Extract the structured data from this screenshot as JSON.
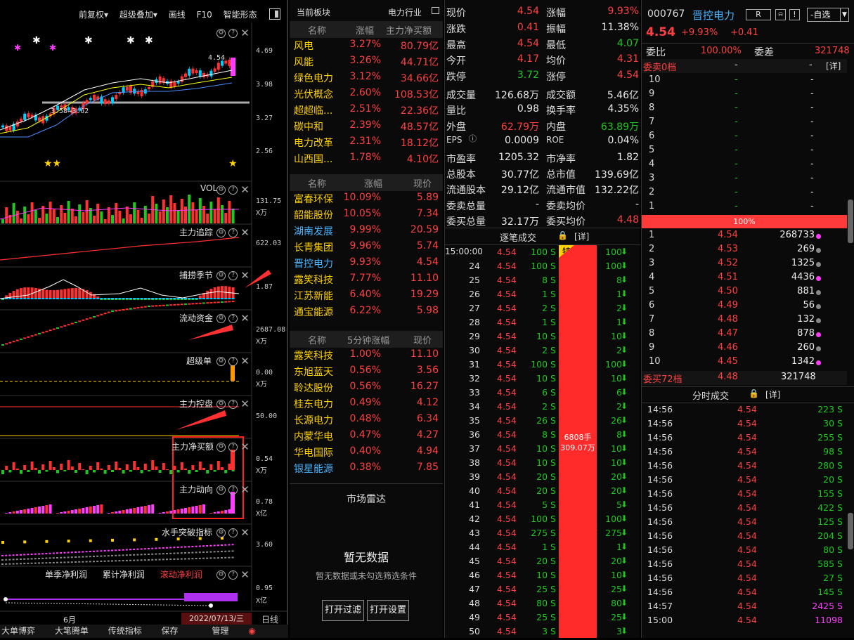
{
  "toolbar": {
    "fq": "前复权▾",
    "overlay": "超级叠加▾",
    "draw": "画线",
    "f10": "F10",
    "pattern": "智能形态"
  },
  "kline_axis": [
    "4.69",
    "3.98",
    "3.27",
    "2.56"
  ],
  "kline_annot": {
    "high": "4.54",
    "low": "3.58→3.62"
  },
  "panels": [
    {
      "title": "VOL",
      "axis": [
        "131.75",
        "X万"
      ]
    },
    {
      "title": "主力追踪",
      "axis": [
        "622.03"
      ]
    },
    {
      "title": "捕捞季节",
      "axis": [
        "1.87"
      ]
    },
    {
      "title": "流动资金",
      "axis": [
        "2687.08",
        "X万"
      ]
    },
    {
      "title": "超级单",
      "axis": [
        "0.00",
        "X万"
      ]
    },
    {
      "title": "主力控盘",
      "axis": [
        "50.00"
      ]
    },
    {
      "title": "主力净买额",
      "axis": [
        "0.54",
        "X万"
      ]
    },
    {
      "title": "主力动向",
      "axis": [
        "0.78",
        "X亿"
      ]
    },
    {
      "title": "水手突破指标",
      "axis": [
        "3.60"
      ]
    },
    {
      "title": "",
      "axis": [
        "0.95",
        "X亿"
      ]
    }
  ],
  "profit_legend": [
    "单季净利润",
    "累计净利润",
    "滚动净利润"
  ],
  "date_axis": {
    "month": "6月",
    "date": "2022/07/13/三",
    "period": "日线"
  },
  "bottom_tabs": [
    "大单博弈",
    "大笔腾单",
    "传统指标",
    "保存",
    "管理"
  ],
  "sector": {
    "header": {
      "label": "当前板块",
      "name": "电力行业"
    },
    "table1": {
      "cols": [
        "名称",
        "涨幅",
        "主力净买额"
      ],
      "rows": [
        [
          "风电",
          "3.27%",
          "80.79亿"
        ],
        [
          "风能",
          "3.26%",
          "44.71亿"
        ],
        [
          "绿色电力",
          "3.12%",
          "34.66亿"
        ],
        [
          "光伏概念",
          "2.60%",
          "108.53亿"
        ],
        [
          "超超临...",
          "2.51%",
          "22.36亿"
        ],
        [
          "碳中和",
          "2.39%",
          "48.57亿"
        ],
        [
          "电力改革",
          "2.31%",
          "18.12亿"
        ],
        [
          "山西国...",
          "1.78%",
          "4.10亿"
        ]
      ]
    },
    "table2": {
      "cols": [
        "名称",
        "涨幅",
        "现价"
      ],
      "rows": [
        [
          "富春环保",
          "10.09%",
          "5.89"
        ],
        [
          "韶能股份",
          "10.05%",
          "7.34"
        ],
        [
          "湖南发展",
          "9.99%",
          "20.59"
        ],
        [
          "长青集团",
          "9.96%",
          "5.74"
        ],
        [
          "晋控电力",
          "9.93%",
          "4.54"
        ],
        [
          "露笑科技",
          "7.77%",
          "11.10"
        ],
        [
          "江苏新能",
          "6.40%",
          "19.29"
        ],
        [
          "通宝能源",
          "6.22%",
          "5.98"
        ]
      ]
    },
    "table3": {
      "cols": [
        "名称",
        "5分钟涨幅",
        "现价"
      ],
      "rows": [
        [
          "露笑科技",
          "1.00%",
          "11.10"
        ],
        [
          "东旭蓝天",
          "0.56%",
          "3.56"
        ],
        [
          "聆达股份",
          "0.56%",
          "16.27"
        ],
        [
          "桂东电力",
          "0.49%",
          "4.12"
        ],
        [
          "长源电力",
          "0.48%",
          "6.34"
        ],
        [
          "内蒙华电",
          "0.47%",
          "4.27"
        ],
        [
          "华电国际",
          "0.40%",
          "4.94"
        ],
        [
          "银星能源",
          "0.38%",
          "7.85"
        ]
      ]
    },
    "radar": {
      "title": "市场雷达",
      "empty": "暂无数据",
      "hint": "暂无数据或未勾选筛选条件",
      "btn_filter": "打开过滤",
      "btn_settings": "打开设置"
    }
  },
  "quote": {
    "rows": [
      [
        "现价",
        "4.54",
        "涨幅",
        "9.93%"
      ],
      [
        "涨跌",
        "0.41",
        "振幅",
        "11.38%"
      ],
      [
        "最高",
        "4.54",
        "最低",
        "4.07"
      ],
      [
        "今开",
        "4.17",
        "均价",
        "4.31"
      ],
      [
        "跌停",
        "3.72",
        "涨停",
        "4.54"
      ],
      [
        "成交量",
        "126.68万",
        "成交额",
        "5.46亿"
      ],
      [
        "量比",
        "0.98",
        "换手率",
        "4.35%"
      ],
      [
        "外盘",
        "62.79万",
        "内盘",
        "63.89万"
      ],
      [
        "EPS",
        "0.0009",
        "ROE",
        "0.04%"
      ],
      [
        "市盈率",
        "1205.32",
        "市净率",
        "1.82"
      ],
      [
        "总股本",
        "30.77亿",
        "总市值",
        "139.69亿"
      ],
      [
        "流通股本",
        "29.12亿",
        "流通市值",
        "132.22亿"
      ],
      [
        "委卖总量",
        "-",
        "委卖均价",
        "-"
      ],
      [
        "委买总量",
        "32.17万",
        "委买均价",
        "4.48"
      ]
    ],
    "ticks_title": "逐笔成交",
    "detail": "[详]",
    "first_time": "15:00:00",
    "ticks": [
      [
        "",
        "4.54",
        "100 S",
        "100"
      ],
      [
        "24",
        "4.54",
        "100 S",
        "100"
      ],
      [
        "25",
        "4.54",
        "8 S",
        "8"
      ],
      [
        "26",
        "4.54",
        "1 S",
        "1"
      ],
      [
        "27",
        "4.54",
        "2 S",
        "2"
      ],
      [
        "28",
        "4.54",
        "1 S",
        "1"
      ],
      [
        "29",
        "4.54",
        "10 S",
        "10"
      ],
      [
        "30",
        "4.54",
        "2 S",
        "2"
      ],
      [
        "31",
        "4.54",
        "100 S",
        "100"
      ],
      [
        "32",
        "4.54",
        "10 S",
        "10"
      ],
      [
        "33",
        "4.54",
        "6 S",
        "6"
      ],
      [
        "34",
        "4.54",
        "2 S",
        "2"
      ],
      [
        "35",
        "4.54",
        "26 S",
        "26"
      ],
      [
        "36",
        "4.54",
        "8 S",
        "8"
      ],
      [
        "37",
        "4.54",
        "10 S",
        "10"
      ],
      [
        "38",
        "4.54",
        "10 S",
        "10"
      ],
      [
        "39",
        "4.54",
        "20 S",
        "20"
      ],
      [
        "40",
        "4.54",
        "20 S",
        "20"
      ],
      [
        "41",
        "4.54",
        "5 S",
        "5"
      ],
      [
        "42",
        "4.54",
        "100 S",
        "100"
      ],
      [
        "43",
        "4.54",
        "275 S",
        "275"
      ],
      [
        "44",
        "4.54",
        "1 S",
        "1"
      ],
      [
        "45",
        "4.54",
        "20 S",
        "20"
      ],
      [
        "46",
        "4.54",
        "10 S",
        "10"
      ],
      [
        "47",
        "4.54",
        "25 S",
        "25"
      ],
      [
        "48",
        "4.54",
        "80 S",
        "80"
      ],
      [
        "49",
        "4.54",
        "25 S",
        "25"
      ],
      [
        "50",
        "4.54",
        "3 S",
        "3"
      ]
    ],
    "big_order": {
      "tag": "特",
      "lots": "6808手",
      "amount": "309.07万"
    }
  },
  "stock": {
    "code": "000767",
    "name": "晋控电力",
    "badge": "R",
    "add_btn": "-自选",
    "price": "4.54",
    "pct": "+9.93%",
    "chg": "+0.41",
    "weibi_label": "委比",
    "weibi": "100.00%",
    "weicha_label": "委差",
    "weicha": "321748",
    "sell_label": "委卖0档",
    "detail": "[详]",
    "sell_levels": [
      "10",
      "9",
      "8",
      "7",
      "6",
      "5",
      "4",
      "3",
      "2",
      "1"
    ],
    "bar": "100%",
    "buy_levels": [
      [
        "1",
        "4.54",
        "268733"
      ],
      [
        "2",
        "4.53",
        "269"
      ],
      [
        "3",
        "4.52",
        "1325"
      ],
      [
        "4",
        "4.51",
        "4436"
      ],
      [
        "5",
        "4.50",
        "881"
      ],
      [
        "6",
        "4.49",
        "56"
      ],
      [
        "7",
        "4.48",
        "132"
      ],
      [
        "8",
        "4.47",
        "878"
      ],
      [
        "9",
        "4.46",
        "260"
      ],
      [
        "10",
        "4.45",
        "1342"
      ]
    ],
    "buy_total_label": "委买72档",
    "buy_total_price": "4.48",
    "buy_total_vol": "321748",
    "minute_title": "分时成交",
    "minute": [
      [
        "14:56",
        "4.54",
        "223 S"
      ],
      [
        "14:56",
        "4.54",
        "30 S"
      ],
      [
        "14:56",
        "4.54",
        "255 S"
      ],
      [
        "14:56",
        "4.54",
        "98 S"
      ],
      [
        "14:56",
        "4.54",
        "280 S"
      ],
      [
        "14:56",
        "4.54",
        "20 S"
      ],
      [
        "14:56",
        "4.54",
        "155 S"
      ],
      [
        "14:56",
        "4.54",
        "422 S"
      ],
      [
        "14:56",
        "4.54",
        "125 S"
      ],
      [
        "14:56",
        "4.54",
        "204 S"
      ],
      [
        "14:56",
        "4.54",
        "80 S"
      ],
      [
        "14:56",
        "4.54",
        "585 S"
      ],
      [
        "14:56",
        "4.54",
        "27 S"
      ],
      [
        "14:56",
        "4.54",
        "145 S"
      ],
      [
        "14:57",
        "4.54",
        "2425 S"
      ],
      [
        "15:00",
        "4.54",
        "11098"
      ]
    ]
  },
  "colors": {
    "up": "#ff4040",
    "down": "#1ec81e",
    "accent": "#ff3333",
    "blue": "#46b4ff"
  }
}
